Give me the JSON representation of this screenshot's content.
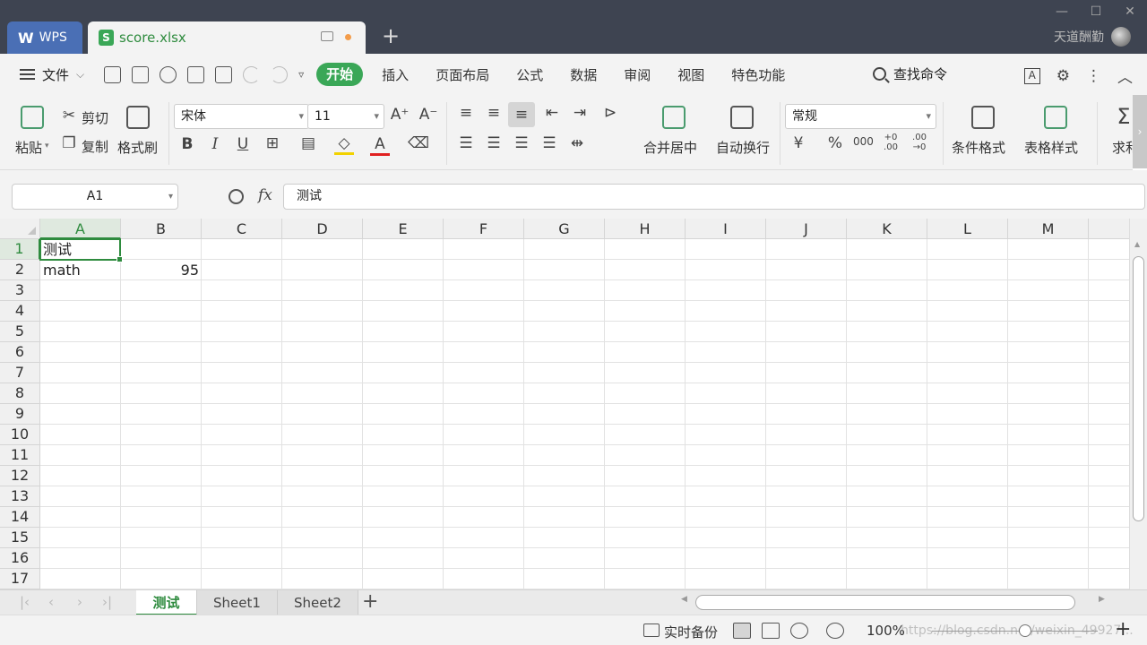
{
  "titlebar": {
    "app_tab": "WPS",
    "file_tab": "score.xlsx",
    "new_tab": "+",
    "user_name": "天道酬勤"
  },
  "menubar": {
    "file": "文件",
    "tabs": [
      "开始",
      "插入",
      "页面布局",
      "公式",
      "数据",
      "审阅",
      "视图",
      "特色功能"
    ],
    "search": "查找命令"
  },
  "ribbon": {
    "paste": "粘贴",
    "cut": "剪切",
    "copy": "复制",
    "format_painter": "格式刷",
    "font_name": "宋体",
    "font_size": "11",
    "merge_center": "合并居中",
    "wrap_text": "自动换行",
    "number_format": "常规",
    "conditional_format": "条件格式",
    "table_style": "表格样式",
    "sum": "求和",
    "bold": "B",
    "italic": "I",
    "underline": "U",
    "font_color": "A",
    "percent": "%",
    "thousands": "000",
    "inc_decimal": "+0 .00",
    "dec_decimal": ".00 →0"
  },
  "formula_bar": {
    "name_box": "A1",
    "fx": "fx",
    "content": "测试"
  },
  "grid": {
    "columns": [
      "A",
      "B",
      "C",
      "D",
      "E",
      "F",
      "G",
      "H",
      "I",
      "J",
      "K",
      "L",
      "M"
    ],
    "rows": [
      "1",
      "2",
      "3",
      "4",
      "5",
      "6",
      "7",
      "8",
      "9",
      "10",
      "11",
      "12",
      "13",
      "14",
      "15",
      "16",
      "17"
    ],
    "cells": {
      "A1": "测试",
      "A2": "math",
      "B2": "95"
    },
    "active_cell": "A1"
  },
  "sheets": {
    "tabs": [
      "测试",
      "Sheet1",
      "Sheet2"
    ],
    "active": "测试",
    "add": "+"
  },
  "statusbar": {
    "backup": "实时备份",
    "zoom": "100%",
    "zoom_in": "+",
    "watermark": "https://blog.csdn.net/weixin_49927..."
  },
  "colors": {
    "accent": "#3aa757",
    "titlebar": "#3e4451",
    "wps_tab": "#4a6fb5"
  }
}
